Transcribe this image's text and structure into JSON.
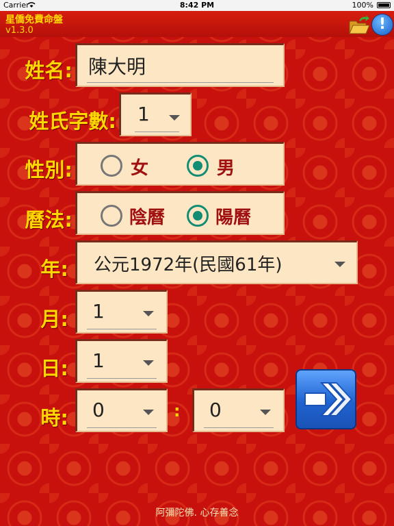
{
  "status_bar": {
    "carrier": "Carrier",
    "time": "8:42 PM",
    "battery": "100%"
  },
  "app": {
    "title": "星僑免費命盤",
    "version": "v1.3.0"
  },
  "form": {
    "name": {
      "label": "姓名:",
      "value": "陳大明"
    },
    "surname_count": {
      "label": "姓氏字數:",
      "value": "1"
    },
    "gender": {
      "label": "性別:",
      "options": [
        "女",
        "男"
      ],
      "selected": "男"
    },
    "calendar": {
      "label": "曆法:",
      "options": [
        "陰曆",
        "陽曆"
      ],
      "selected": "陽曆"
    },
    "year": {
      "label": "年:",
      "value": "公元1972年(民國61年)"
    },
    "month": {
      "label": "月:",
      "value": "1"
    },
    "day": {
      "label": "日:",
      "value": "1"
    },
    "time": {
      "label": "時:",
      "hour": "0",
      "separator": ":",
      "minute": "0"
    }
  },
  "footer": {
    "text": "阿彌陀佛. 心存善念"
  },
  "icons": {
    "folder": "folder-open-icon",
    "info": "info-icon",
    "go": "arrow-right-icon"
  },
  "colors": {
    "background": "#c8100c",
    "label": "#ffd700",
    "field": "#fde6c4",
    "radio_checked": "#138c74",
    "radio_text": "#a01010"
  }
}
